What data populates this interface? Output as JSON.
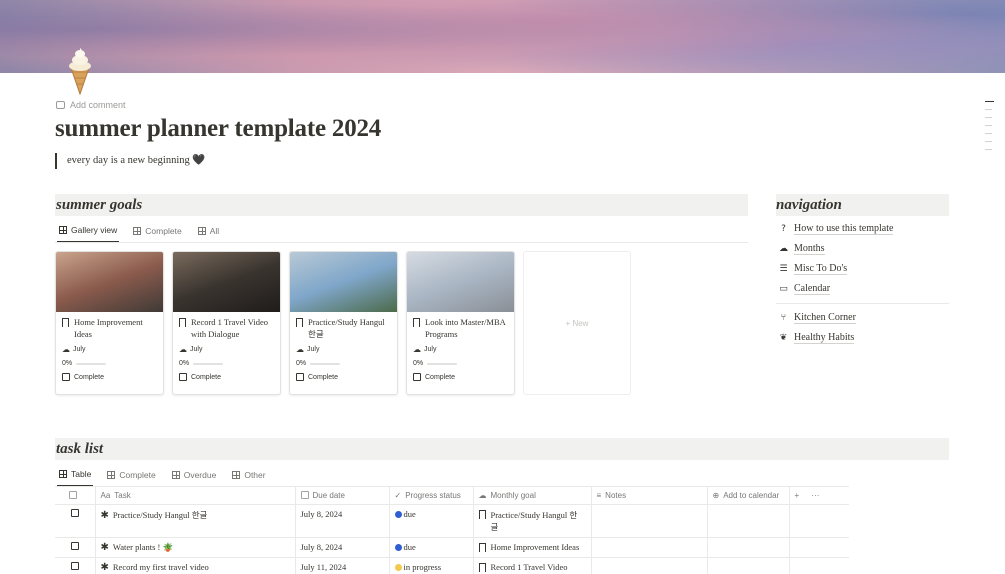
{
  "page": {
    "icon": "soft-serve-ice-cream-icon",
    "add_comment": "Add comment",
    "title": "summer planner template 2024",
    "quote": "every day is a new beginning 🖤"
  },
  "goals": {
    "header": "summer goals",
    "tabs": [
      "Gallery view",
      "Complete",
      "All"
    ],
    "new_label": "+ New",
    "cards": [
      {
        "title": "Home Improvement Ideas",
        "month": "July",
        "progress": "0%",
        "check_label": "Complete",
        "image": "living-room-photo",
        "colors": [
          "#8b5b4d",
          "#c9a48c",
          "#3f3a36"
        ]
      },
      {
        "title": "Record 1 Travel Video with Dialogue",
        "month": "July",
        "progress": "0%",
        "check_label": "Complete",
        "image": "camera-crew-photo",
        "colors": [
          "#3a342f",
          "#7a6a5c",
          "#1f1c1a"
        ]
      },
      {
        "title": "Practice/Study Hangul 한글",
        "month": "July",
        "progress": "0%",
        "check_label": "Complete",
        "image": "korean-flag-photo",
        "colors": [
          "#7fa6c9",
          "#b8c9d6",
          "#4c6a4a"
        ]
      },
      {
        "title": "Look into Master/MBA Programs",
        "month": "July",
        "progress": "0%",
        "check_label": "Complete",
        "image": "graduation-caps-photo",
        "colors": [
          "#aab6c4",
          "#d6dbe2",
          "#8a8f96"
        ]
      }
    ]
  },
  "navigation": {
    "header": "navigation",
    "items": [
      {
        "label": "How to use this template",
        "icon": "question-icon",
        "glyph": "?"
      },
      {
        "label": "Months",
        "icon": "weather-icon",
        "glyph": "☁"
      },
      {
        "label": "Misc To Do's",
        "icon": "list-icon",
        "glyph": "☰"
      },
      {
        "label": "Calendar",
        "icon": "calendar-icon",
        "glyph": "▭"
      }
    ],
    "items2": [
      {
        "label": "Kitchen Corner",
        "icon": "fork-knife-icon",
        "glyph": "⑂"
      },
      {
        "label": "Healthy Habits",
        "icon": "brain-icon",
        "glyph": "❦"
      }
    ]
  },
  "tasks": {
    "header": "task list",
    "tabs": [
      "Table",
      "Complete",
      "Overdue",
      "Other"
    ],
    "columns": [
      "Task",
      "Due date",
      "Progress status",
      "Monthly goal",
      "Notes",
      "Add to calendar"
    ],
    "add_col": "+",
    "more_col": "···",
    "rows": [
      {
        "task": "Practice/Study Hangul 한글",
        "due": "July 8, 2024",
        "status": "due",
        "status_color": "#2f5fd0",
        "goal": "Practice/Study Hangul 한글"
      },
      {
        "task": "Water plants ! 🪴",
        "due": "July 8, 2024",
        "status": "due",
        "status_color": "#2f5fd0",
        "goal": "Home Improvement Ideas"
      },
      {
        "task": "Record my first travel video",
        "due": "July 11, 2024",
        "status": "in progress",
        "status_color": "#f2c94c",
        "goal": "Record 1 Travel Video"
      }
    ]
  }
}
